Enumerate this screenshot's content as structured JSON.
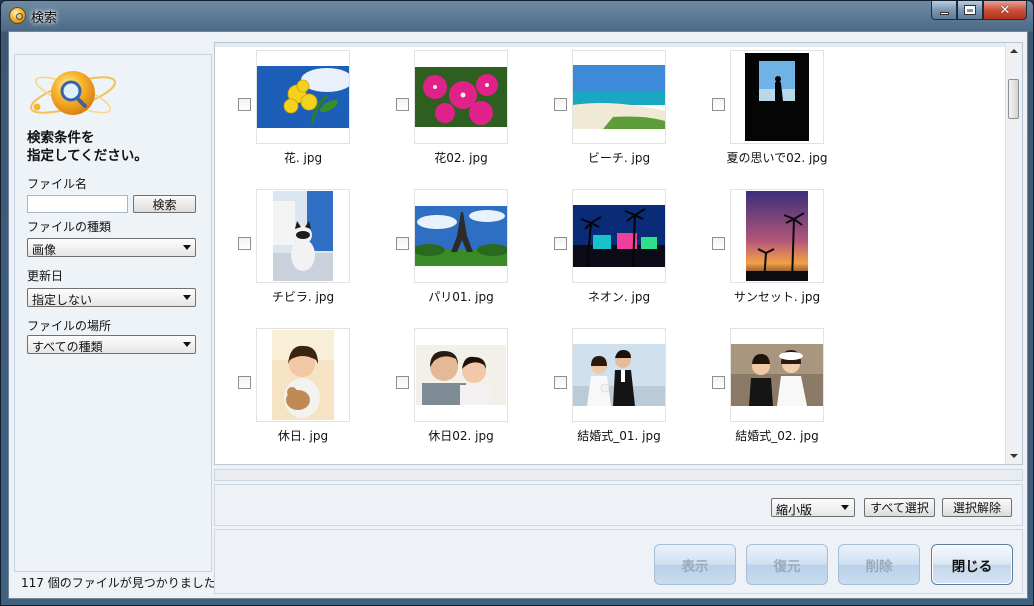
{
  "window": {
    "title": "検索",
    "colors": {
      "frame": "#41607e",
      "client": "#eef1f5",
      "close": "#c9523a"
    }
  },
  "sidebar": {
    "heading_line1": "検索条件を",
    "heading_line2": "指定してください。",
    "filename_label": "ファイル名",
    "filename_value": "",
    "search_button": "検索",
    "filetype_label": "ファイルの種類",
    "filetype_value": "画像",
    "modified_label": "更新日",
    "modified_value": "指定しない",
    "location_label": "ファイルの場所",
    "location_value": "すべての種類"
  },
  "status": {
    "count": "117",
    "suffix": " 個のファイルが見つかりました。"
  },
  "results": [
    {
      "name": "花. jpg",
      "icon": "yellow-flower-photo"
    },
    {
      "name": "花02. jpg",
      "icon": "pink-flower-photo"
    },
    {
      "name": "ビーチ. jpg",
      "icon": "beach-photo"
    },
    {
      "name": "夏の思いで02. jpg",
      "icon": "window-silhouette-photo"
    },
    {
      "name": "チビラ. jpg",
      "icon": "cat-photo"
    },
    {
      "name": "パリ01. jpg",
      "icon": "eiffel-tower-photo"
    },
    {
      "name": "ネオン. jpg",
      "icon": "neon-palms-photo"
    },
    {
      "name": "サンセット. jpg",
      "icon": "sunset-palms-photo"
    },
    {
      "name": "休日. jpg",
      "icon": "girl-with-toy-photo"
    },
    {
      "name": "休日02. jpg",
      "icon": "father-daughter-photo"
    },
    {
      "name": "結婚式_01. jpg",
      "icon": "wedding-couple-photo"
    },
    {
      "name": "結婚式_02. jpg",
      "icon": "wedding-kids-photo"
    }
  ],
  "toolbar": {
    "view_mode": "縮小版",
    "select_all": "すべて選択",
    "deselect": "選択解除"
  },
  "actions": {
    "show": "表示",
    "restore": "復元",
    "delete": "削除",
    "close": "閉じる"
  }
}
